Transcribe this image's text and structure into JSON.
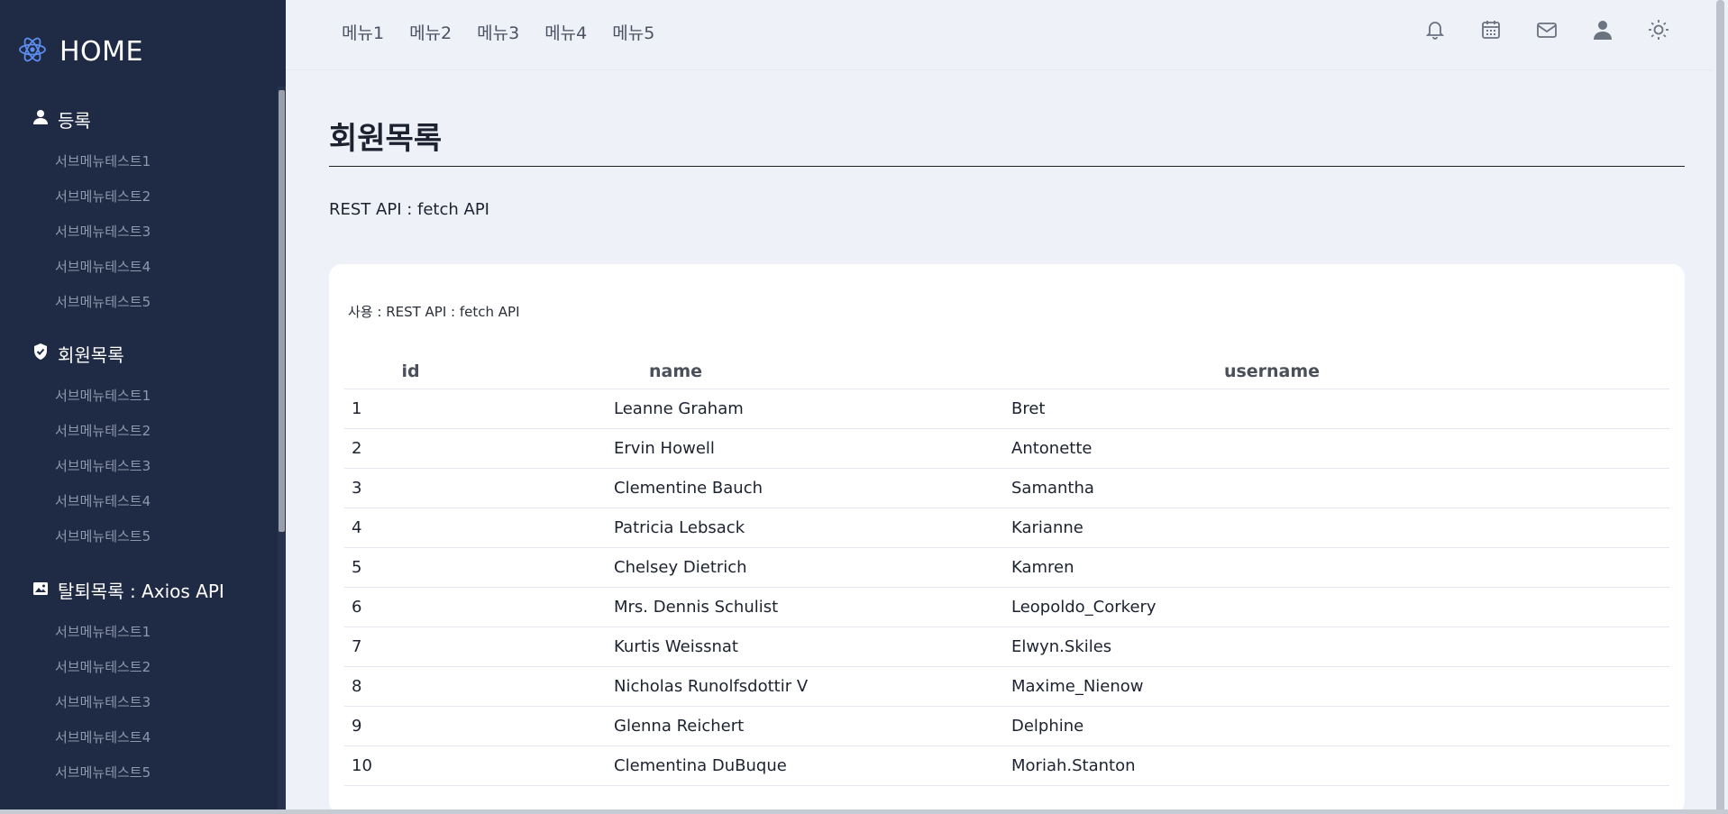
{
  "sidebar": {
    "brand": "HOME",
    "groups": [
      {
        "title": "등록",
        "icon": "user-icon",
        "items": [
          "서브메뉴테스트1",
          "서브메뉴테스트2",
          "서브메뉴테스트3",
          "서브메뉴테스트4",
          "서브메뉴테스트5"
        ]
      },
      {
        "title": "회원목록",
        "icon": "shield-check-icon",
        "items": [
          "서브메뉴테스트1",
          "서브메뉴테스트2",
          "서브메뉴테스트3",
          "서브메뉴테스트4",
          "서브메뉴테스트5"
        ]
      },
      {
        "title": "탈퇴목록 : Axios API",
        "icon": "image-icon",
        "items": [
          "서브메뉴테스트1",
          "서브메뉴테스트2",
          "서브메뉴테스트3",
          "서브메뉴테스트4",
          "서브메뉴테스트5"
        ]
      }
    ]
  },
  "topnav": [
    "메뉴1",
    "메뉴2",
    "메뉴3",
    "메뉴4",
    "메뉴5"
  ],
  "top_icons": [
    "bell-icon",
    "calendar-icon",
    "mail-icon",
    "user-icon",
    "sun-icon"
  ],
  "main": {
    "title": "회원목록",
    "subtitle": "REST API : fetch API",
    "card_caption": "사용 : REST API : fetch API",
    "table": {
      "headers": [
        "id",
        "name",
        "username"
      ],
      "rows": [
        [
          "1",
          "Leanne Graham",
          "Bret"
        ],
        [
          "2",
          "Ervin Howell",
          "Antonette"
        ],
        [
          "3",
          "Clementine Bauch",
          "Samantha"
        ],
        [
          "4",
          "Patricia Lebsack",
          "Karianne"
        ],
        [
          "5",
          "Chelsey Dietrich",
          "Kamren"
        ],
        [
          "6",
          "Mrs. Dennis Schulist",
          "Leopoldo_Corkery"
        ],
        [
          "7",
          "Kurtis Weissnat",
          "Elwyn.Skiles"
        ],
        [
          "8",
          "Nicholas Runolfsdottir V",
          "Maxime_Nienow"
        ],
        [
          "9",
          "Glenna Reichert",
          "Delphine"
        ],
        [
          "10",
          "Clementina DuBuque",
          "Moriah.Stanton"
        ]
      ]
    }
  },
  "colors": {
    "sidebar_bg": "#1f2a44",
    "page_bg": "#eef2f8",
    "accent_icon": "#5b8def"
  }
}
